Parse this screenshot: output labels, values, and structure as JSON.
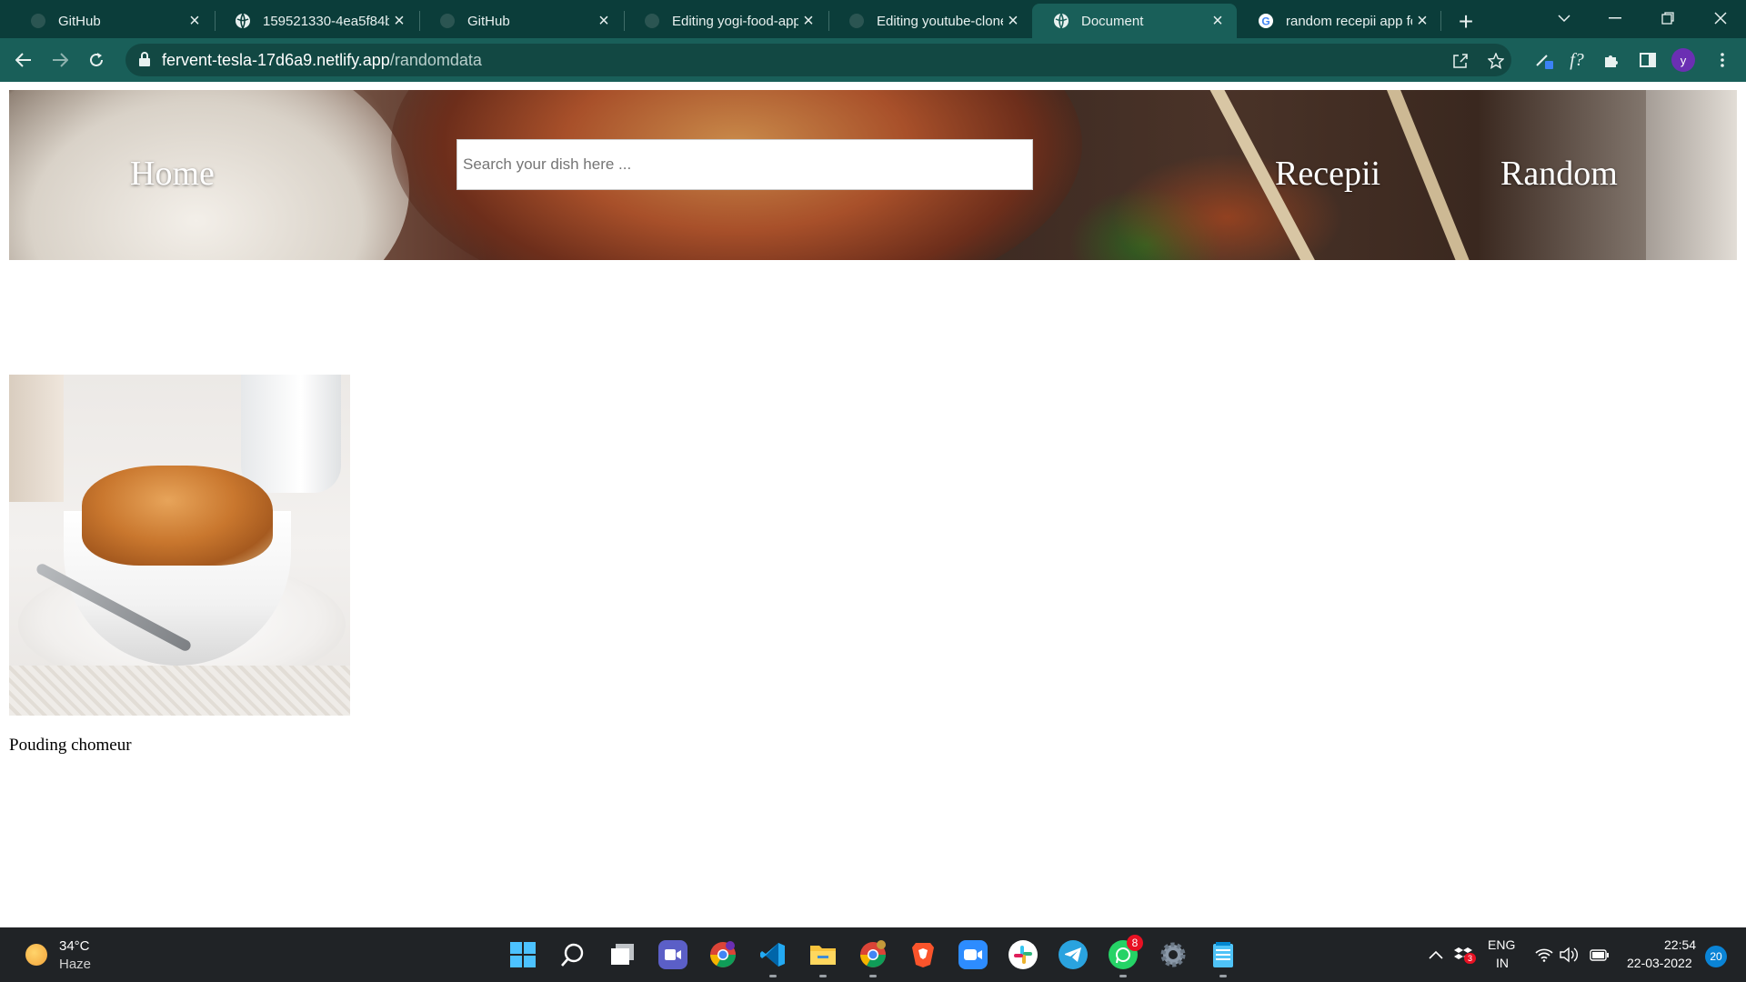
{
  "browser": {
    "tabs": [
      {
        "title": "GitHub",
        "favicon": "github-icon",
        "active": false
      },
      {
        "title": "159521330-4ea5f84b",
        "favicon": "globe-icon",
        "active": false
      },
      {
        "title": "GitHub",
        "favicon": "github-icon",
        "active": false
      },
      {
        "title": "Editing yogi-food-app",
        "favicon": "github-icon",
        "active": false
      },
      {
        "title": "Editing youtube-clone",
        "favicon": "github-icon",
        "active": false
      },
      {
        "title": "Document",
        "favicon": "globe-icon",
        "active": true
      },
      {
        "title": "random recepii app fo",
        "favicon": "google-icon",
        "active": false
      }
    ],
    "url_host": "fervent-tesla-17d6a9.netlify.app",
    "url_path": "/randomdata",
    "profile_initial": "y",
    "theme_color": "#195f59"
  },
  "header": {
    "home_label": "Home",
    "search_placeholder": "Search your dish here ...",
    "recepii_label": "Recepii",
    "random_label": "Random"
  },
  "recipe": {
    "name": "Pouding chomeur"
  },
  "taskbar": {
    "weather_temp": "34°C",
    "weather_desc": "Haze",
    "apps": [
      {
        "name": "start-icon"
      },
      {
        "name": "search-icon"
      },
      {
        "name": "task-view-icon"
      },
      {
        "name": "teams-chat-icon"
      },
      {
        "name": "chrome-icon"
      },
      {
        "name": "vscode-icon"
      },
      {
        "name": "file-explorer-icon"
      },
      {
        "name": "chrome-canary-icon"
      },
      {
        "name": "brave-icon"
      },
      {
        "name": "zoom-icon"
      },
      {
        "name": "slack-icon"
      },
      {
        "name": "telegram-icon"
      },
      {
        "name": "whatsapp-icon"
      },
      {
        "name": "settings-icon"
      },
      {
        "name": "notepad-icon"
      }
    ],
    "whatsapp_badge": "8",
    "tray_badge": "3",
    "lang_primary": "ENG",
    "lang_secondary": "IN",
    "time": "22:54",
    "date": "22-03-2022",
    "notifications": "20"
  }
}
